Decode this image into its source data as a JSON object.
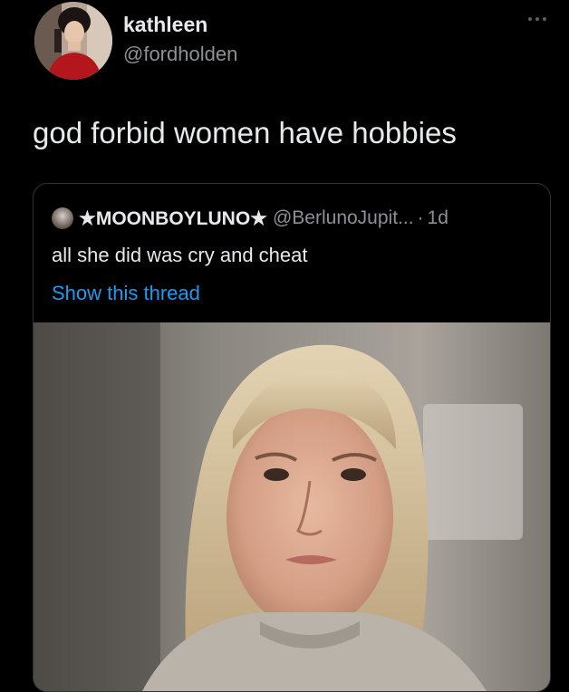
{
  "author": {
    "name": "kathleen",
    "handle": "@fordholden",
    "avatar_icon": "profile-photo-woman-red-top"
  },
  "more_icon": "ellipsis-icon",
  "tweet": {
    "text": "god forbid women have hobbies"
  },
  "quoted_tweet": {
    "name": "★MOONBOYLUNO★",
    "handle": "@BerlunoJupit...",
    "separator": "·",
    "time": "1d",
    "text": "all she did was cry and cheat",
    "show_thread": "Show this thread",
    "media_icon": "photo-blonde-woman-crying"
  },
  "colors": {
    "background": "#000000",
    "primary_text": "#e7e9ea",
    "secondary_text": "#8b9198",
    "link": "#1d9bf0",
    "border": "#2f3336"
  }
}
